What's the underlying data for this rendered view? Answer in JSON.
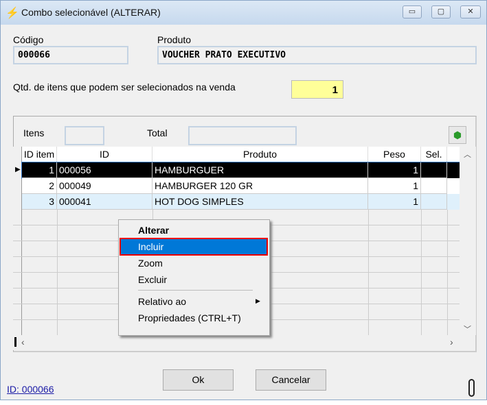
{
  "window": {
    "title": "Combo selecionável (ALTERAR)",
    "minimize": "▭",
    "maximize": "▢",
    "close": "✕"
  },
  "form": {
    "codigo_label": "Código",
    "codigo_value": "000066",
    "produto_label": "Produto",
    "produto_value": "VOUCHER PRATO EXECUTIVO",
    "qtd_label": "Qtd. de itens que podem ser selecionados na venda",
    "qtd_value": "1"
  },
  "panel": {
    "itens_label": "Itens",
    "itens_value": "",
    "total_label": "Total",
    "total_value": ""
  },
  "grid": {
    "columns": [
      "ID item",
      "ID",
      "Produto",
      "Peso",
      "Sel."
    ],
    "rows": [
      {
        "id_item": "1",
        "id": "000056",
        "produto": "HAMBURGUER",
        "peso": "1",
        "sel": ""
      },
      {
        "id_item": "2",
        "id": "000049",
        "produto": "HAMBURGER 120 GR",
        "peso": "1",
        "sel": ""
      },
      {
        "id_item": "3",
        "id": "000041",
        "produto": "HOT DOG SIMPLES",
        "peso": "1",
        "sel": ""
      }
    ]
  },
  "menu": {
    "items": [
      "Alterar",
      "Incluir",
      "Zoom",
      "Excluir",
      "Relativo ao",
      "Propriedades (CTRL+T)"
    ],
    "highlight_color": "#0078d7"
  },
  "buttons": {
    "ok": "Ok",
    "cancel": "Cancelar"
  },
  "footer": {
    "id_link": "ID: 000066"
  }
}
